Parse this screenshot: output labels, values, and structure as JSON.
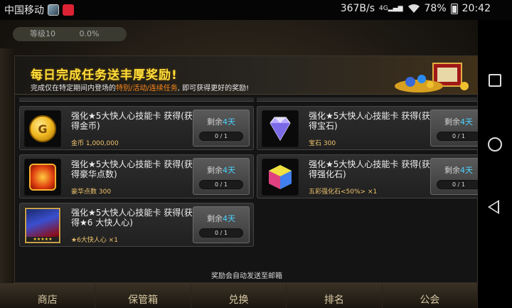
{
  "status_bar": {
    "carrier": "中国移动",
    "speed": "367B/s",
    "network": "4G",
    "battery": "78%",
    "time": "20:42"
  },
  "game": {
    "level": "等级10",
    "percent": "0.0%"
  },
  "banner": {
    "title": "每日完成任务送丰厚奖励!",
    "sub_prefix": "完成仅在特定期间内登场的",
    "sub_highlight": "特别/活动/连续任务",
    "sub_suffix": ", 即可获得更好的奖励!"
  },
  "cards": [
    {
      "title": "强化★5大快人心技能卡 获得(获得金币)",
      "reward": "金币 1,000,000",
      "remain_prefix": "剩余",
      "remain_day": "4天",
      "progress": "0 / 1",
      "icon": "gold-coin-icon"
    },
    {
      "title": "强化★5大快人心技能卡 获得(获得宝石)",
      "reward": "宝石 300",
      "remain_prefix": "剩余",
      "remain_day": "4天",
      "progress": "0 / 1",
      "icon": "diamond-icon"
    },
    {
      "title": "强化★5大快人心技能卡 获得(获得豪华点数)",
      "reward": "豪华点数 300",
      "remain_prefix": "剩余",
      "remain_day": "4天",
      "progress": "0 / 1",
      "icon": "luxury-points-icon"
    },
    {
      "title": "强化★5大快人心技能卡 获得(获得强化石)",
      "reward": "五彩强化石<50%> ×1",
      "remain_prefix": "剩余",
      "remain_day": "4天",
      "progress": "0 / 1",
      "icon": "rainbow-stone-icon"
    },
    {
      "title": "强化★5大快人心技能卡 获得(获得★6 大快人心)",
      "reward": "★6大快人心 ×1",
      "remain_prefix": "剩余",
      "remain_day": "4天",
      "progress": "0 / 1",
      "icon": "skill-card-icon"
    }
  ],
  "footer_note": "奖励会自动发送至邮箱",
  "bottom_nav": [
    "商店",
    "保管箱",
    "兑换",
    "排名",
    "公会"
  ]
}
